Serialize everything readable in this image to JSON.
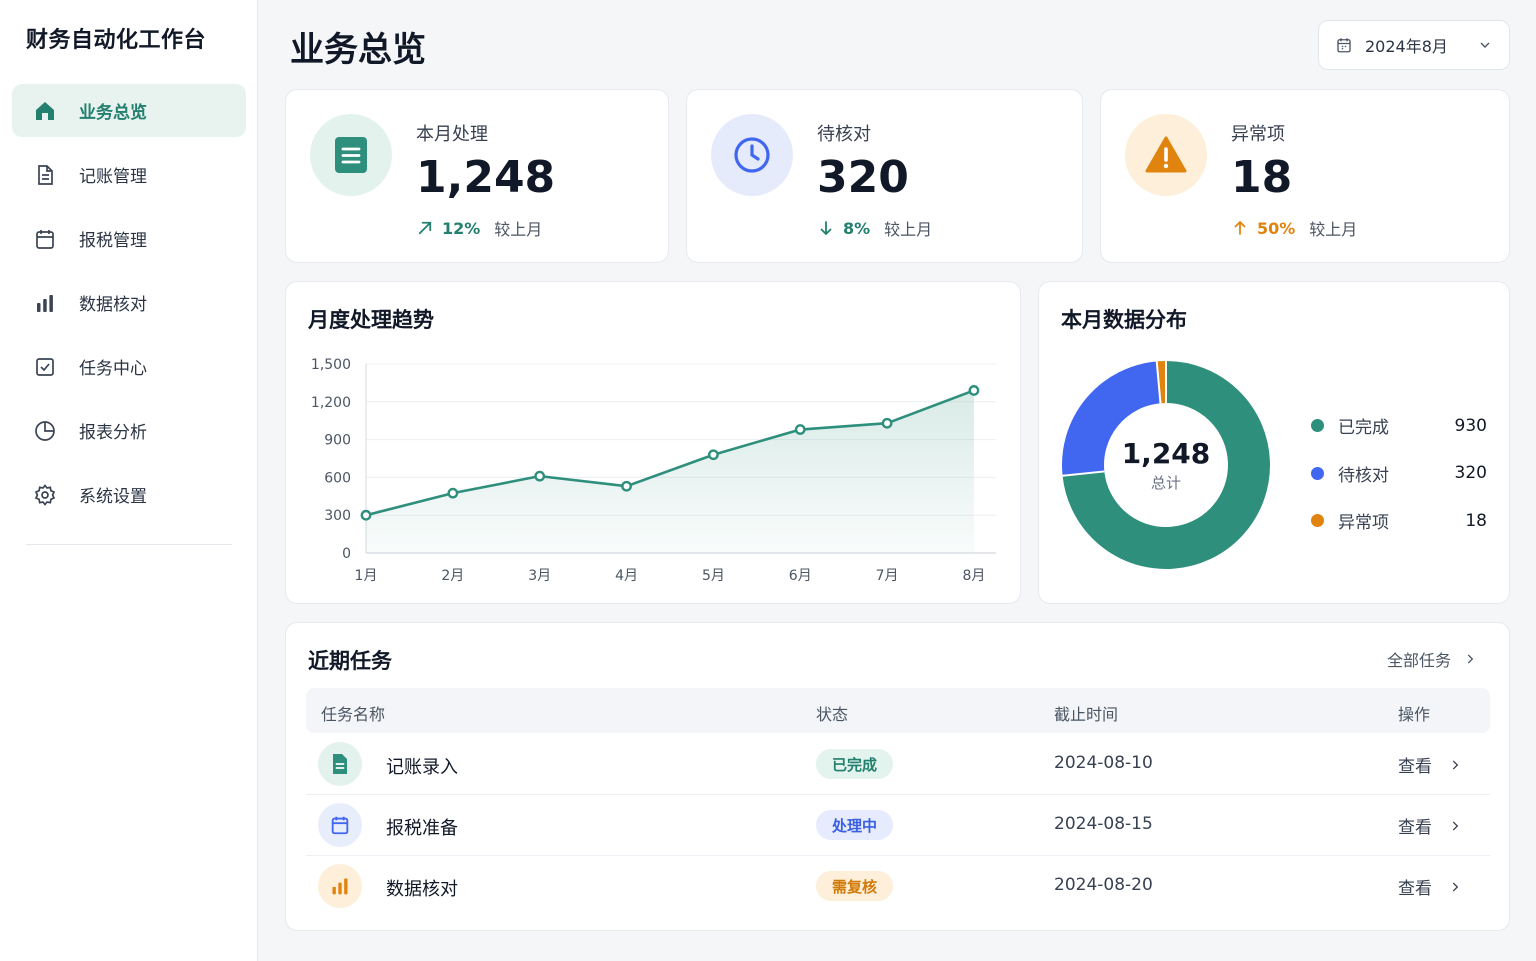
{
  "app": {
    "title": "财务自动化工作台"
  },
  "sidebar": {
    "items": [
      {
        "label": "业务总览",
        "icon": "home-icon",
        "active": true
      },
      {
        "label": "记账管理",
        "icon": "document-icon",
        "active": false
      },
      {
        "label": "报税管理",
        "icon": "calendar-icon",
        "active": false
      },
      {
        "label": "数据核对",
        "icon": "bar-chart-icon",
        "active": false
      },
      {
        "label": "任务中心",
        "icon": "checkbox-icon",
        "active": false
      },
      {
        "label": "报表分析",
        "icon": "pie-chart-icon",
        "active": false
      },
      {
        "label": "系统设置",
        "icon": "gear-icon",
        "active": false
      }
    ]
  },
  "header": {
    "title": "业务总览",
    "date": "2024年8月"
  },
  "stats": [
    {
      "label": "本月处理",
      "value": "1,248",
      "trend": "12%",
      "trend_dir": "up-right",
      "note": "较上月",
      "color": "#23806e",
      "icon": "document-icon"
    },
    {
      "label": "待核对",
      "value": "320",
      "trend": "8%",
      "trend_dir": "down",
      "note": "较上月",
      "color": "#23806e",
      "icon": "clock-icon"
    },
    {
      "label": "异常项",
      "value": "18",
      "trend": "50%",
      "trend_dir": "up",
      "note": "较上月",
      "color": "#e0840f",
      "icon": "warning-icon"
    }
  ],
  "trend_chart": {
    "title": "月度处理趋势"
  },
  "distribution": {
    "title": "本月数据分布",
    "total": "1,248",
    "total_label": "总计",
    "items": [
      {
        "label": "已完成",
        "value": "930",
        "color": "#2e8f7c"
      },
      {
        "label": "待核对",
        "value": "320",
        "color": "#4167f0"
      },
      {
        "label": "异常项",
        "value": "18",
        "color": "#e0840f"
      }
    ]
  },
  "chart_data": [
    {
      "type": "line",
      "title": "月度处理趋势",
      "categories": [
        "1月",
        "2月",
        "3月",
        "4月",
        "5月",
        "6月",
        "7月",
        "8月"
      ],
      "values": [
        300,
        475,
        610,
        530,
        780,
        980,
        1030,
        1290
      ],
      "ylim": [
        0,
        1500
      ],
      "yticks": [
        "0",
        "300",
        "600",
        "900",
        "1,200",
        "1,500"
      ],
      "grid": true,
      "colors": {
        "line": "#2e8f7c"
      }
    },
    {
      "type": "pie",
      "title": "本月数据分布",
      "categories": [
        "已完成",
        "待核对",
        "异常项"
      ],
      "values": [
        930,
        320,
        18
      ],
      "colors": [
        "#2e8f7c",
        "#4167f0",
        "#e0840f"
      ]
    }
  ],
  "tasks": {
    "title": "近期任务",
    "all_label": "全部任务",
    "columns": [
      "任务名称",
      "状态",
      "截止时间",
      "操作"
    ],
    "rows": [
      {
        "name": "记账录入",
        "status": "已完成",
        "status_fg": "#23806e",
        "status_bg": "#e3f3ee",
        "due": "2024-08-10",
        "action": "查看",
        "icon": "document-icon",
        "icon_fg": "#2e8f7c",
        "icon_bg": "#e4f2ee"
      },
      {
        "name": "报税准备",
        "status": "处理中",
        "status_fg": "#3a5fe0",
        "status_bg": "#e6ecfd",
        "due": "2024-08-15",
        "action": "查看",
        "icon": "calendar-icon",
        "icon_fg": "#4167f0",
        "icon_bg": "#e8edfc"
      },
      {
        "name": "数据核对",
        "status": "需复核",
        "status_fg": "#d27a08",
        "status_bg": "#fdefd9",
        "due": "2024-08-20",
        "action": "查看",
        "icon": "bar-chart-icon",
        "icon_fg": "#e0840f",
        "icon_bg": "#fdefd9"
      }
    ]
  }
}
